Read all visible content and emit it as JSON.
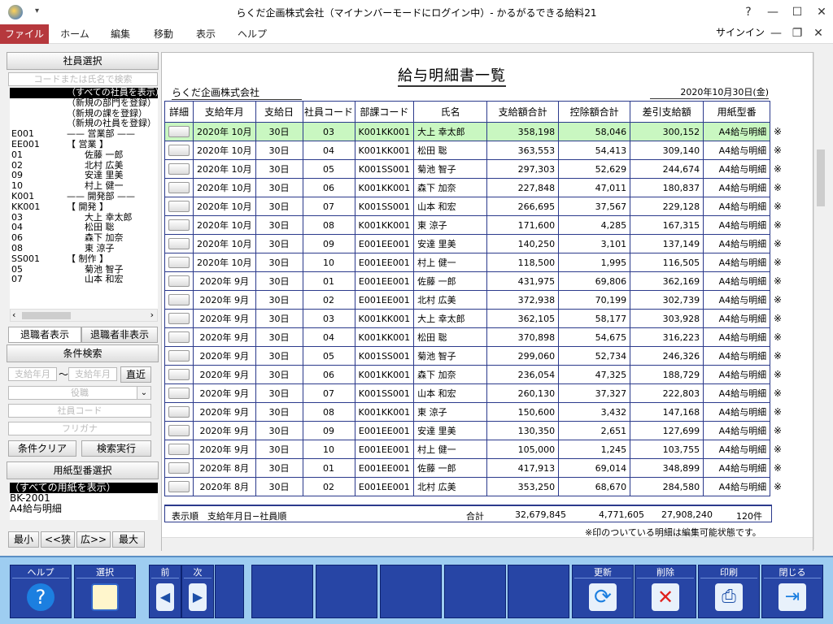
{
  "window": {
    "title": "らくだ企画株式会社（マイナンバーモードにログイン中）- かるがるできる給料21",
    "help_glyph": "?",
    "min_glyph": "—",
    "max_glyph": "☐",
    "close_glyph": "✕"
  },
  "ribbon": {
    "tabs": [
      "ファイル",
      "ホーム",
      "編集",
      "移動",
      "表示",
      "ヘルプ"
    ],
    "signin": "サインイン"
  },
  "left": {
    "employee_select_label": "社員選択",
    "search_placeholder": "コードまたは氏名で検索",
    "tree": [
      {
        "code": "",
        "name": "（すべての社員を表示）",
        "sel": true
      },
      {
        "code": "",
        "name": "（新規の部門を登録）"
      },
      {
        "code": "",
        "name": "（新規の課を登録）"
      },
      {
        "code": "",
        "name": "（新規の社員を登録）"
      },
      {
        "code": "E001",
        "name": "—— 営業部 ——"
      },
      {
        "code": "EE001",
        "name": "【 営業 】"
      },
      {
        "code": "01",
        "name": "　　佐藤 一郎"
      },
      {
        "code": "02",
        "name": "　　北村 広美"
      },
      {
        "code": "09",
        "name": "　　安達 里美"
      },
      {
        "code": "10",
        "name": "　　村上 健一"
      },
      {
        "code": "K001",
        "name": "—— 開発部 ——"
      },
      {
        "code": "KK001",
        "name": "【 開発 】"
      },
      {
        "code": "03",
        "name": "　　大上 幸太郎"
      },
      {
        "code": "04",
        "name": "　　松田 聡"
      },
      {
        "code": "06",
        "name": "　　森下 加奈"
      },
      {
        "code": "08",
        "name": "　　東 涼子"
      },
      {
        "code": "SS001",
        "name": "【 制作 】"
      },
      {
        "code": "05",
        "name": "　　菊池 智子"
      },
      {
        "code": "07",
        "name": "　　山本 和宏"
      }
    ],
    "retired_show": "退職者表示",
    "retired_hide": "退職者非表示",
    "condition_label": "条件検索",
    "month_from": "支給年月",
    "tilde": "〜",
    "month_to": "支給年月",
    "recent_btn": "直近",
    "position_placeholder": "役職",
    "code_placeholder": "社員コード",
    "kana_placeholder": "フリガナ",
    "clear_btn": "条件クリア",
    "search_btn": "検索実行",
    "paper_select_label": "用紙型番選択",
    "paper_items": [
      "（すべての用紙を表示）",
      "BK-2001",
      "A4給与明細"
    ],
    "zoom_btns": [
      "最小",
      "<<狭",
      "広>>",
      "最大"
    ]
  },
  "main": {
    "title": "給与明細書一覧",
    "company": "らくだ企画株式会社",
    "date": "2020年10月30日(金)",
    "headers": [
      "詳細",
      "支給年月",
      "支給日",
      "社員コード",
      "部課コード",
      "氏名",
      "支給額合計",
      "控除額合計",
      "差引支給額",
      "用紙型番"
    ],
    "rows": [
      [
        "2020年 10月",
        "30日",
        "03",
        "K001KK001",
        "大上 幸太郎",
        "358,198",
        "58,046",
        "300,152",
        "A4給与明細"
      ],
      [
        "2020年 10月",
        "30日",
        "04",
        "K001KK001",
        "松田 聡",
        "363,553",
        "54,413",
        "309,140",
        "A4給与明細"
      ],
      [
        "2020年 10月",
        "30日",
        "05",
        "K001SS001",
        "菊池 智子",
        "297,303",
        "52,629",
        "244,674",
        "A4給与明細"
      ],
      [
        "2020年 10月",
        "30日",
        "06",
        "K001KK001",
        "森下 加奈",
        "227,848",
        "47,011",
        "180,837",
        "A4給与明細"
      ],
      [
        "2020年 10月",
        "30日",
        "07",
        "K001SS001",
        "山本 和宏",
        "266,695",
        "37,567",
        "229,128",
        "A4給与明細"
      ],
      [
        "2020年 10月",
        "30日",
        "08",
        "K001KK001",
        "東 涼子",
        "171,600",
        "4,285",
        "167,315",
        "A4給与明細"
      ],
      [
        "2020年 10月",
        "30日",
        "09",
        "E001EE001",
        "安達 里美",
        "140,250",
        "3,101",
        "137,149",
        "A4給与明細"
      ],
      [
        "2020年 10月",
        "30日",
        "10",
        "E001EE001",
        "村上 健一",
        "118,500",
        "1,995",
        "116,505",
        "A4給与明細"
      ],
      [
        "2020年 9月",
        "30日",
        "01",
        "E001EE001",
        "佐藤 一郎",
        "431,975",
        "69,806",
        "362,169",
        "A4給与明細"
      ],
      [
        "2020年 9月",
        "30日",
        "02",
        "E001EE001",
        "北村 広美",
        "372,938",
        "70,199",
        "302,739",
        "A4給与明細"
      ],
      [
        "2020年 9月",
        "30日",
        "03",
        "K001KK001",
        "大上 幸太郎",
        "362,105",
        "58,177",
        "303,928",
        "A4給与明細"
      ],
      [
        "2020年 9月",
        "30日",
        "04",
        "K001KK001",
        "松田 聡",
        "370,898",
        "54,675",
        "316,223",
        "A4給与明細"
      ],
      [
        "2020年 9月",
        "30日",
        "05",
        "K001SS001",
        "菊池 智子",
        "299,060",
        "52,734",
        "246,326",
        "A4給与明細"
      ],
      [
        "2020年 9月",
        "30日",
        "06",
        "K001KK001",
        "森下 加奈",
        "236,054",
        "47,325",
        "188,729",
        "A4給与明細"
      ],
      [
        "2020年 9月",
        "30日",
        "07",
        "K001SS001",
        "山本 和宏",
        "260,130",
        "37,327",
        "222,803",
        "A4給与明細"
      ],
      [
        "2020年 9月",
        "30日",
        "08",
        "K001KK001",
        "東 涼子",
        "150,600",
        "3,432",
        "147,168",
        "A4給与明細"
      ],
      [
        "2020年 9月",
        "30日",
        "09",
        "E001EE001",
        "安達 里美",
        "130,350",
        "2,651",
        "127,699",
        "A4給与明細"
      ],
      [
        "2020年 9月",
        "30日",
        "10",
        "E001EE001",
        "村上 健一",
        "105,000",
        "1,245",
        "103,755",
        "A4給与明細"
      ],
      [
        "2020年 8月",
        "30日",
        "01",
        "E001EE001",
        "佐藤 一郎",
        "417,913",
        "69,014",
        "348,899",
        "A4給与明細"
      ],
      [
        "2020年 8月",
        "30日",
        "02",
        "E001EE001",
        "北村 広美",
        "353,250",
        "68,670",
        "284,580",
        "A4給与明細"
      ]
    ],
    "mark": "※",
    "sort_label": "表示順　支給年月日−社員順",
    "total_label": "合計",
    "total_pay": "32,679,845",
    "total_deduct": "4,771,605",
    "total_net": "27,908,240",
    "total_count": "120件",
    "note": "※印のついている明細は編集可能状態です。"
  },
  "fkeys": [
    "ヘルプ",
    "選択",
    "前",
    "次",
    "",
    "",
    "",
    "",
    "",
    "更新",
    "削除",
    "印刷",
    "閉じる"
  ],
  "colors": {
    "file_tab": "#b6383d",
    "selected_row": "#c9f7c1",
    "grid_border": "#2b3a8c",
    "fkey_bg": "#2745a5",
    "bottom_bar": "#9ecdf1"
  }
}
